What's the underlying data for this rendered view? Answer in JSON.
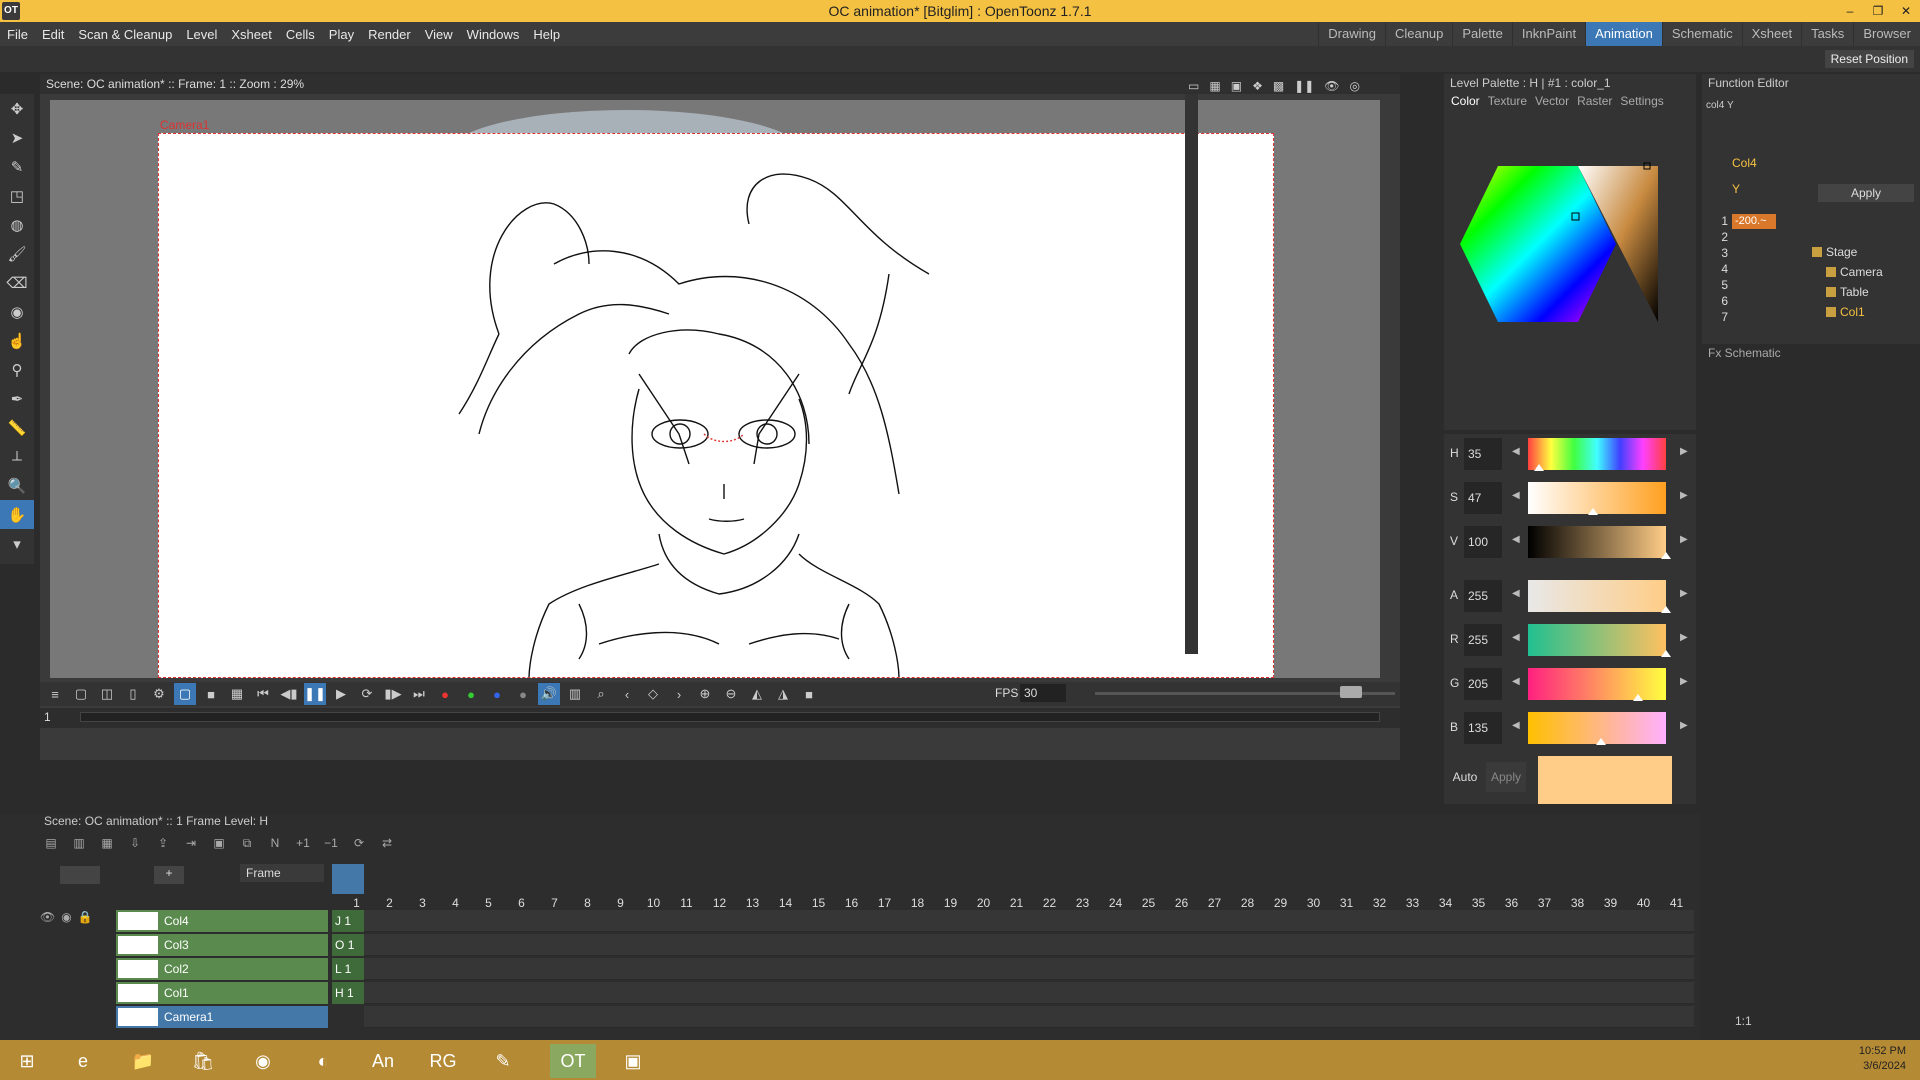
{
  "window": {
    "title": "OC animation* [Bitglim] : OpenToonz 1.7.1",
    "logo": "OT"
  },
  "menu": [
    "File",
    "Edit",
    "Scan & Cleanup",
    "Level",
    "Xsheet",
    "Cells",
    "Play",
    "Render",
    "View",
    "Windows",
    "Help"
  ],
  "rooms": [
    "Drawing",
    "Cleanup",
    "Palette",
    "InknPaint",
    "Animation",
    "Schematic",
    "Xsheet",
    "Tasks",
    "Browser"
  ],
  "active_room": "Animation",
  "reset_position": "Reset Position",
  "viewer": {
    "header": "Scene: OC animation*  ::  Frame: 1  ::  Zoom : 29%",
    "camera_label": "Camera1",
    "fps_label": "FPS",
    "fps_value": "30",
    "frame_value": "1"
  },
  "level_palette": {
    "header": "Level Palette : H | #1 : color_1",
    "tabs": [
      "Color",
      "Texture",
      "Vector",
      "Raster",
      "Settings"
    ],
    "active_tab": "Color",
    "sliders": [
      {
        "label": "H",
        "value": "35",
        "knob": 0.08,
        "grad": "linear-gradient(90deg,#ff4040,#ffff40,#40ff40,#40ffff,#4040ff,#ff40ff,#ff4040)"
      },
      {
        "label": "S",
        "value": "47",
        "knob": 0.47,
        "grad": "linear-gradient(90deg,#ffffff,#ffa020)"
      },
      {
        "label": "V",
        "value": "100",
        "knob": 1.0,
        "grad": "linear-gradient(90deg,#000000,#ffcd87)"
      },
      {
        "label": "A",
        "value": "255",
        "knob": 1.0,
        "grad": "linear-gradient(90deg,#e8e8e8,#ffcd87)"
      },
      {
        "label": "R",
        "value": "255",
        "knob": 1.0,
        "grad": "linear-gradient(90deg,#20c090,#ffc060)"
      },
      {
        "label": "G",
        "value": "205",
        "knob": 0.8,
        "grad": "linear-gradient(90deg,#ff2080,#ffff40)"
      },
      {
        "label": "B",
        "value": "135",
        "knob": 0.53,
        "grad": "linear-gradient(90deg,#ffc000,#ffb0ff)"
      }
    ],
    "auto": "Auto",
    "apply": "Apply",
    "current_color": "#ffcd87"
  },
  "function_editor": {
    "header": "Function Editor",
    "channel_top": "col4 Y",
    "col4": "Col4",
    "y": "Y",
    "rows": [
      "1",
      "2",
      "3",
      "4",
      "5",
      "6",
      "7"
    ],
    "value": "-200.~",
    "apply": "Apply",
    "tree": [
      "Stage",
      "Camera",
      "Table",
      "Col1"
    ],
    "fx_schematic": "Fx Schematic"
  },
  "xsheet": {
    "header": "Scene: OC animation*  ::  1 Frame  Level: H",
    "frame_mode": "Frame",
    "frames": [
      "1",
      "2",
      "3",
      "4",
      "5",
      "6",
      "7",
      "8",
      "9",
      "10",
      "11",
      "12",
      "13",
      "14",
      "15",
      "16",
      "17",
      "18",
      "19",
      "20",
      "21",
      "22",
      "23",
      "24",
      "25",
      "26",
      "27",
      "28",
      "29",
      "30",
      "31",
      "32",
      "33",
      "34",
      "35",
      "36",
      "37",
      "38",
      "39",
      "40",
      "41"
    ],
    "layers": [
      {
        "name": "Col4",
        "cell": "J",
        "frame": "1"
      },
      {
        "name": "Col3",
        "cell": "O",
        "frame": "1"
      },
      {
        "name": "Col2",
        "cell": "L",
        "frame": "1"
      },
      {
        "name": "Col1",
        "cell": "H",
        "frame": "1"
      },
      {
        "name": "Camera1",
        "cell": "",
        "frame": ""
      }
    ],
    "zoom_label": "1:1"
  },
  "taskbar": {
    "clock_time": "10:52 PM",
    "clock_date": "3/6/2024"
  }
}
